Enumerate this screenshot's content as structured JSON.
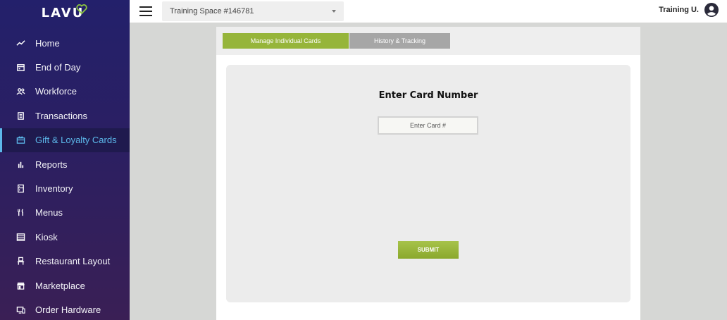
{
  "brand": {
    "logo_text": "LAVU",
    "accent": "#8cc63f"
  },
  "sidebar": {
    "items": [
      {
        "label": "Home",
        "icon": "trend-line-icon",
        "active": false
      },
      {
        "label": "End of Day",
        "icon": "calendar-icon",
        "active": false
      },
      {
        "label": "Workforce",
        "icon": "people-icon",
        "active": false
      },
      {
        "label": "Transactions",
        "icon": "receipt-icon",
        "active": false
      },
      {
        "label": "Gift & Loyalty Cards",
        "icon": "gift-card-icon",
        "active": true
      },
      {
        "label": "Reports",
        "icon": "bar-chart-icon",
        "active": false
      },
      {
        "label": "Inventory",
        "icon": "inventory-icon",
        "active": false
      },
      {
        "label": "Menus",
        "icon": "fork-knife-icon",
        "active": false
      },
      {
        "label": "Kiosk",
        "icon": "kiosk-icon",
        "active": false
      },
      {
        "label": "Restaurant Layout",
        "icon": "chair-icon",
        "active": false
      },
      {
        "label": "Marketplace",
        "icon": "storefront-icon",
        "active": false
      },
      {
        "label": "Order Hardware",
        "icon": "devices-icon",
        "active": false
      }
    ]
  },
  "topbar": {
    "location": "Training Space #146781",
    "user_name": "Training U."
  },
  "tabs": [
    {
      "label": "Manage Individual Cards",
      "active": true,
      "color": "#96b53a"
    },
    {
      "label": "History & Tracking",
      "active": false,
      "color": "#a6a6a6"
    }
  ],
  "card_form": {
    "title": "Enter Card Number",
    "input_value": "",
    "input_placeholder": "Enter Card #",
    "submit_label": "SUBMIT"
  }
}
